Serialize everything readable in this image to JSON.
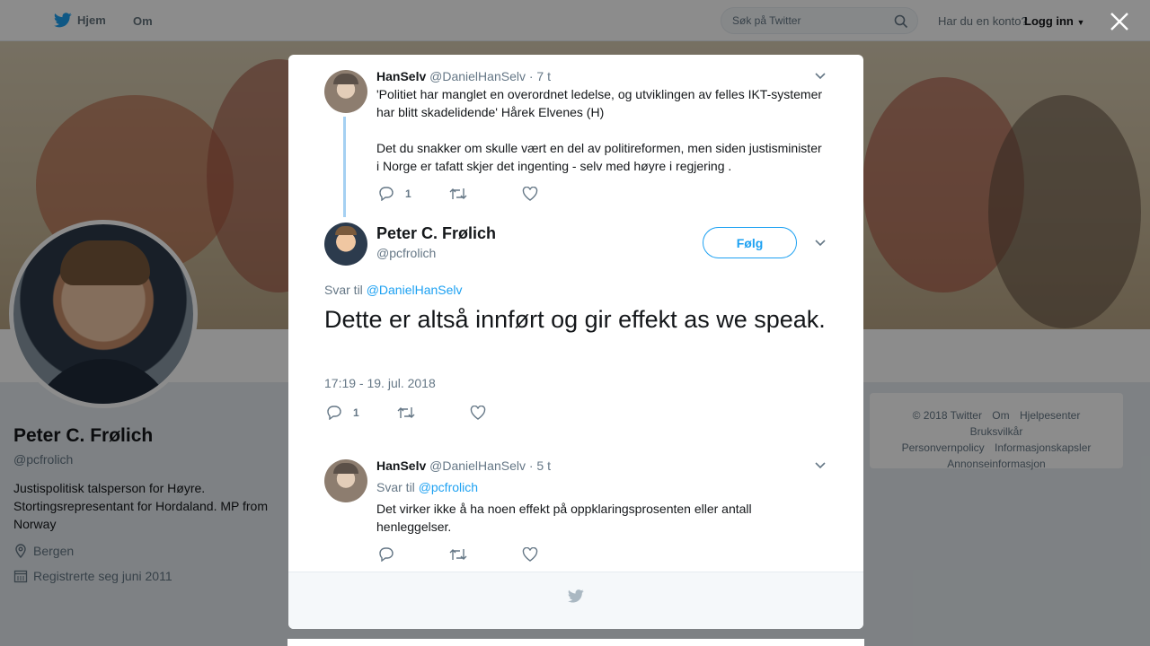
{
  "topnav": {
    "home_label": "Hjem",
    "about_label": "Om",
    "search_placeholder": "Søk på Twitter",
    "account_question": "Har du en konto?",
    "login_label": "Logg inn"
  },
  "profile": {
    "name": "Peter C. Frølich",
    "handle": "@pcfrolich",
    "bio": "Justispolitisk talsperson for Høyre. Stortingsrepresentant for Hordaland. MP from Norway",
    "location": "Bergen",
    "joined": "Registrerte seg juni 2011"
  },
  "site_footer": {
    "links": [
      "© 2018 Twitter",
      "Om",
      "Hjelpesenter",
      "Bruksvilkår",
      "Personvernpolicy",
      "Informasjonskapsler",
      "Annonseinformasjon"
    ]
  },
  "modal": {
    "parent_tweet": {
      "name": "HanSelv",
      "handle": "@DanielHanSelv",
      "time": "· 7 t",
      "text1": "'Politiet har manglet en overordnet ledelse, og utviklingen av felles IKT-systemer har blitt skadelidende' Hårek Elvenes (H)",
      "text2": "Det du snakker om skulle vært en del av politireformen, men siden justisminister i Norge er tafatt skjer det ingenting - selv med høyre i regjering .",
      "reply_count": "1"
    },
    "main_tweet": {
      "name": "Peter C. Frølich",
      "handle": "@pcfrolich",
      "follow_label": "Følg",
      "reply_prefix": "Svar til",
      "reply_to": "@DanielHanSelv",
      "text": "Dette er altså innført og gir effekt as we speak.",
      "timestamp": "17:19 - 19. jul. 2018",
      "reply_count": "1"
    },
    "reply_tweet": {
      "name": "HanSelv",
      "handle": "@DanielHanSelv",
      "time": "· 5 t",
      "reply_prefix": "Svar til",
      "reply_to": "@pcfrolich",
      "text": "Det virker ikke å ha noen effekt på oppklaringsprosenten eller antall henleggelser."
    }
  },
  "colors": {
    "accent": "#1da1f2",
    "secondary_text": "#657786",
    "thread_line": "#a5d0f2"
  }
}
